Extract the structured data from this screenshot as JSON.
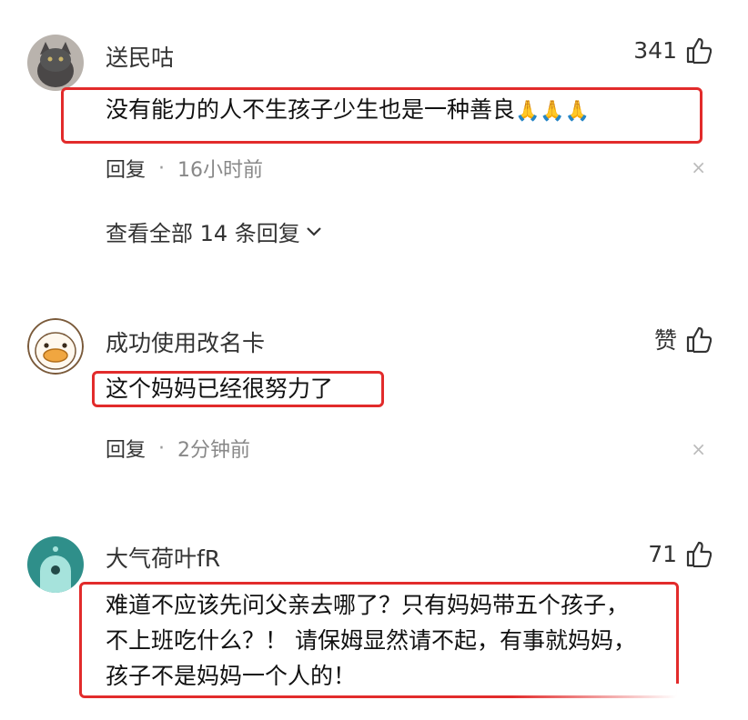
{
  "comments": [
    {
      "username": "送民咕",
      "likes": "341",
      "text": "没有能力的人不生孩子少生也是一种善良",
      "emoji": "🙏🙏🙏",
      "reply_label": "回复",
      "time": "16小时前",
      "view_all": "查看全部 14 条回复",
      "avatar": "cat-avatar"
    },
    {
      "username": "成功使用改名卡",
      "likes": "赞",
      "text": "这个妈妈已经很努力了",
      "reply_label": "回复",
      "time": "2分钟前",
      "avatar": "duck-avatar"
    },
    {
      "username": "大气荷叶fR",
      "likes": "71",
      "text_lines": [
        "难道不应该先问父亲去哪了？只有妈妈带五个孩子，",
        "不上班吃什么？！ 请保姆显然请不起，有事就妈妈，",
        "孩子不是妈妈一个人的！"
      ],
      "avatar": "ghost-avatar"
    }
  ],
  "separator": "·",
  "close_glyph": "×",
  "colors": {
    "highlight": "#e22b2b",
    "meta": "#888888",
    "avatar3_bg": "#2f8f8a"
  }
}
